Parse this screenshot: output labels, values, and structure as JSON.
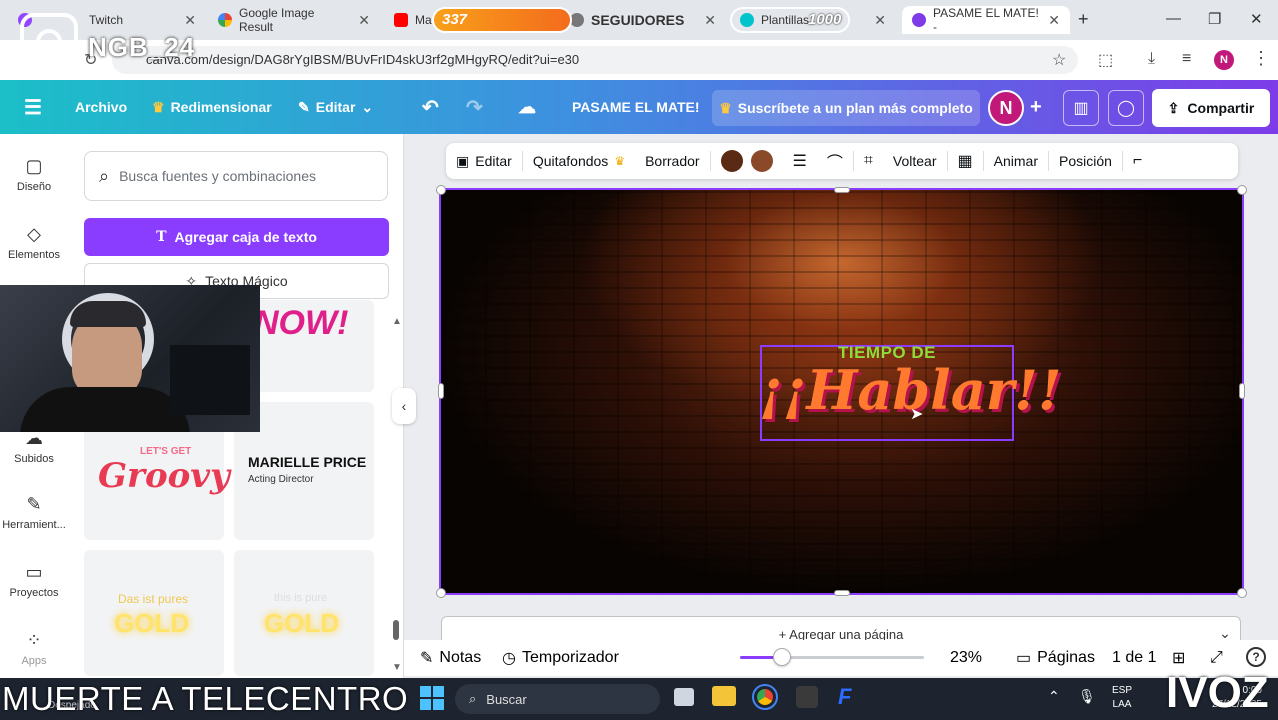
{
  "browser": {
    "tabs": [
      {
        "label": "Twitch"
      },
      {
        "label": "Google Image Result"
      },
      {
        "label": "Ma"
      },
      {
        "label": "SEGUIDORES"
      },
      {
        "label": "Plantillas"
      },
      {
        "label": "PASAME EL MATE! - "
      }
    ],
    "url": "canva.com/design/DAG8rYgIBSM/BUvFrID4skU3rf2gMHgyRQ/edit?ui=e30",
    "profile_initial": "N"
  },
  "overlay": {
    "channel": "NGB_24",
    "goal_1": "337",
    "goal_2": "1000",
    "ticker": "MUERTE A TELECENTRO",
    "brand_right": "IVOZ"
  },
  "canva_header": {
    "file": "Archivo",
    "resize": "Redimensionar",
    "edit": "Editar",
    "title": "PASAME EL MATE!",
    "plan": "Suscríbete a un plan más completo",
    "avatar": "N",
    "share": "Compartir"
  },
  "rail": [
    {
      "label": "Diseño",
      "icon": "layout-icon"
    },
    {
      "label": "Elementos",
      "icon": "shapes-icon"
    },
    {
      "label": "Subidos",
      "icon": "cloud-upload-icon"
    },
    {
      "label": "Herramient...",
      "icon": "pen-tool-icon"
    },
    {
      "label": "Proyectos",
      "icon": "folder-icon"
    },
    {
      "label": "Apps",
      "icon": "apps-grid-icon"
    }
  ],
  "panel": {
    "search_placeholder": "Busca fuentes y combinaciones",
    "add_text": "Agregar caja de texto",
    "magic_text": "Texto Mágico",
    "samples": {
      "now": "NOW!",
      "lets_get": "LET'S GET",
      "groovy": "Groovy",
      "marielle": "MARIELLE PRICE",
      "acting": "Acting Director",
      "das_ist": "Das ist pures",
      "gold1": "GOLD",
      "this_is": "this is pure",
      "gold2": "GOLD"
    }
  },
  "toolbar": {
    "edit": "Editar",
    "bg_remover": "Quitafondos",
    "eraser": "Borrador",
    "color_1": "#5a2a14",
    "color_2": "#8a4a2a",
    "flip": "Voltear",
    "animate": "Animar",
    "position": "Posición"
  },
  "canvas": {
    "subtitle": "TIEMPO DE",
    "headline": "¡¡Hablar!!"
  },
  "add_page": "+ Agregar una página",
  "bottom": {
    "notes": "Notas",
    "timer": "Temporizador",
    "zoom": "23%",
    "zoom_level": 0.23,
    "pages": "Páginas",
    "page_count": "1 de 1"
  },
  "taskbar": {
    "weather": "Despejado",
    "search": "Buscar",
    "lang": "ESP",
    "layout": "LAA",
    "time": "0:00",
    "date": "27/12/2025"
  }
}
